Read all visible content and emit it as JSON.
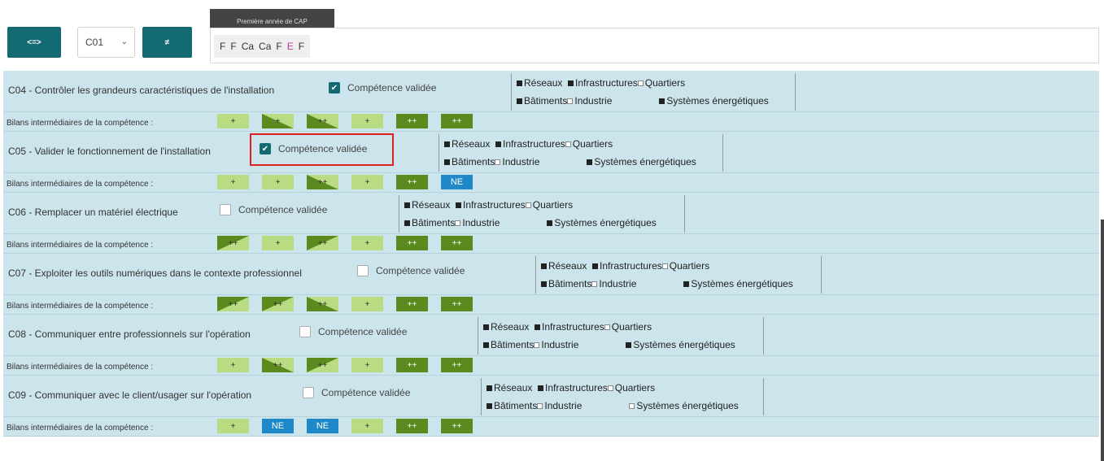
{
  "toolbar": {
    "prev_label": "<=>",
    "next_label": "≠",
    "select_value": "C01"
  },
  "year": {
    "tab_label": "Première année de CAP",
    "grades": [
      {
        "text": "F",
        "kind": "n"
      },
      {
        "text": "F",
        "kind": "n"
      },
      {
        "text": "Ca",
        "kind": "n"
      },
      {
        "text": "Ca",
        "kind": "n"
      },
      {
        "text": "F",
        "kind": "n"
      },
      {
        "text": "E",
        "kind": "e"
      },
      {
        "text": "F",
        "kind": "n"
      }
    ]
  },
  "labels": {
    "valid": "Compétence validée",
    "bilan": "Bilans intermédiaires de la compétence :",
    "reseaux": "Réseaux",
    "infrastructures": "Infrastructures",
    "quartiers": "Quartiers",
    "batiments": "Bâtiments",
    "industrie": "Industrie",
    "systemes": "Systèmes énergétiques"
  },
  "competences": [
    {
      "title": "C04 - Contrôler les grandeurs caractéristiques de l'installation",
      "validated": true,
      "highlighted": false,
      "systemes_checked": true,
      "cells": [
        {
          "kind": "plus",
          "text": "+"
        },
        {
          "kind": "tri2",
          "text": "+"
        },
        {
          "kind": "tri2",
          "text": "++"
        },
        {
          "kind": "plus",
          "text": "+"
        },
        {
          "kind": "pp",
          "text": "++"
        },
        {
          "kind": "pp",
          "text": "++"
        }
      ]
    },
    {
      "title": "C05 - Valider le fonctionnement de l'installation",
      "validated": true,
      "highlighted": true,
      "systemes_checked": true,
      "cells": [
        {
          "kind": "plus",
          "text": "+"
        },
        {
          "kind": "plus",
          "text": "+"
        },
        {
          "kind": "tri2",
          "text": "++"
        },
        {
          "kind": "plus",
          "text": "+"
        },
        {
          "kind": "pp",
          "text": "++"
        },
        {
          "kind": "ne",
          "text": "NE"
        }
      ]
    },
    {
      "title": "C06 - Remplacer un matériel électrique",
      "validated": false,
      "highlighted": false,
      "systemes_checked": true,
      "cells": [
        {
          "kind": "tri",
          "text": "++"
        },
        {
          "kind": "plus",
          "text": "+"
        },
        {
          "kind": "tri",
          "text": "++"
        },
        {
          "kind": "plus",
          "text": "+"
        },
        {
          "kind": "pp",
          "text": "++"
        },
        {
          "kind": "pp",
          "text": "++"
        }
      ]
    },
    {
      "title": "C07 - Exploiter les outils numériques dans le contexte professionnel",
      "validated": false,
      "highlighted": false,
      "systemes_checked": true,
      "cells": [
        {
          "kind": "tri",
          "text": "++"
        },
        {
          "kind": "tri",
          "text": "++"
        },
        {
          "kind": "tri2",
          "text": "++"
        },
        {
          "kind": "plus",
          "text": "+"
        },
        {
          "kind": "pp",
          "text": "++"
        },
        {
          "kind": "pp",
          "text": "++"
        }
      ]
    },
    {
      "title": "C08 - Communiquer entre professionnels sur l'opération",
      "validated": false,
      "highlighted": false,
      "systemes_checked": true,
      "cells": [
        {
          "kind": "plus",
          "text": "+"
        },
        {
          "kind": "tri2",
          "text": "++"
        },
        {
          "kind": "tri",
          "text": "++"
        },
        {
          "kind": "plus",
          "text": "+"
        },
        {
          "kind": "pp",
          "text": "++"
        },
        {
          "kind": "pp",
          "text": "++"
        }
      ]
    },
    {
      "title": "C09 - Communiquer avec le client/usager sur l'opération",
      "validated": false,
      "highlighted": false,
      "systemes_checked": false,
      "cells": [
        {
          "kind": "plus",
          "text": "+"
        },
        {
          "kind": "ne",
          "text": "NE"
        },
        {
          "kind": "ne",
          "text": "NE"
        },
        {
          "kind": "plus",
          "text": "+"
        },
        {
          "kind": "pp",
          "text": "++"
        },
        {
          "kind": "pp",
          "text": "++"
        }
      ]
    }
  ]
}
